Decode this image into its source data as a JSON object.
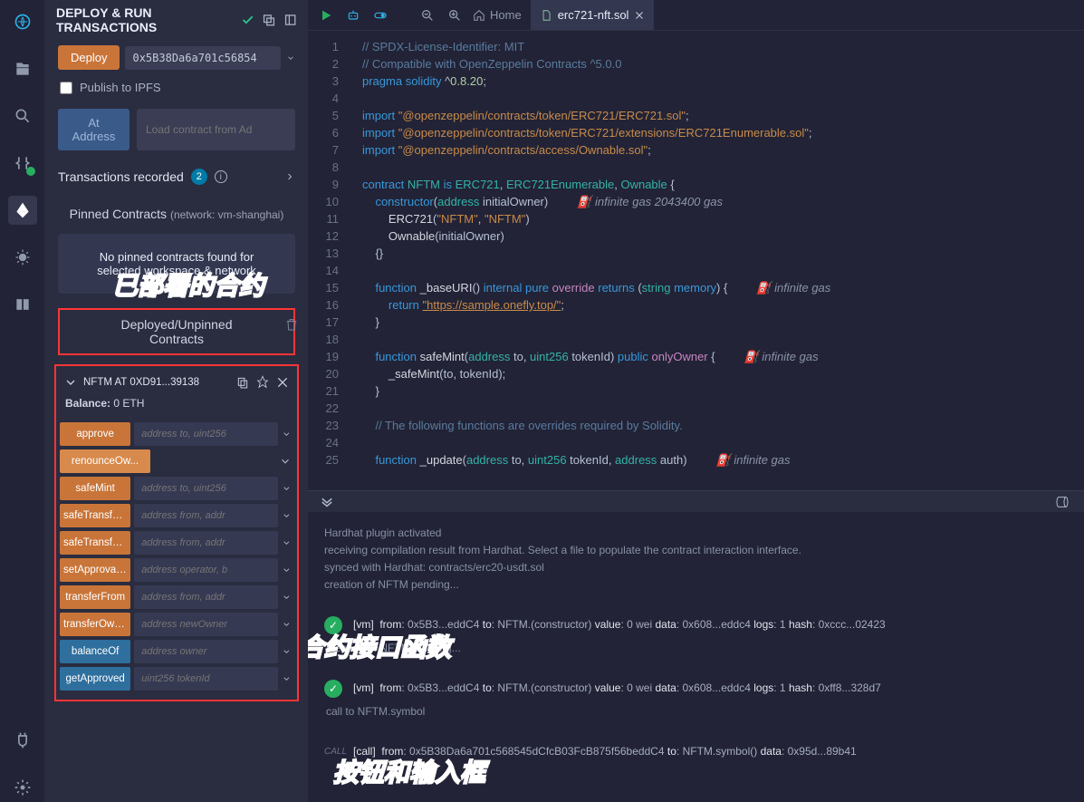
{
  "panel_title": "DEPLOY & RUN TRANSACTIONS",
  "deploy_btn": "Deploy",
  "deploy_addr": "0x5B38Da6a701c56854",
  "publish_ipfs": "Publish to IPFS",
  "at_address": "At Address",
  "load_from_addr": "Load contract from Ad",
  "tx_recorded": "Transactions recorded",
  "tx_count": "2",
  "pinned_title": "Pinned Contracts",
  "pinned_net": "(network: vm-shanghai)",
  "no_pinned_1": "No pinned contracts found for",
  "no_pinned_2": "selected workspace & network",
  "deployed_head_1": "Deployed/Unpinned",
  "deployed_head_2": "Contracts",
  "contract_name": "NFTM AT 0XD91...39138",
  "balance_lbl": "Balance:",
  "balance_val": "0 ETH",
  "fns": [
    {
      "name": "approve",
      "type": "write",
      "ph": "address to, uint256"
    },
    {
      "name": "renounceOw...",
      "type": "writew",
      "ph": ""
    },
    {
      "name": "safeMint",
      "type": "write",
      "ph": "address to, uint256"
    },
    {
      "name": "safeTransferFr...",
      "type": "write",
      "ph": "address from, addr"
    },
    {
      "name": "safeTransferFr...",
      "type": "write",
      "ph": "address from, addr"
    },
    {
      "name": "setApprovalF...",
      "type": "write",
      "ph": "address operator, b"
    },
    {
      "name": "transferFrom",
      "type": "write",
      "ph": "address from, addr"
    },
    {
      "name": "transferOwne...",
      "type": "write",
      "ph": "address newOwner"
    },
    {
      "name": "balanceOf",
      "type": "read",
      "ph": "address owner"
    },
    {
      "name": "getApproved",
      "type": "read",
      "ph": "uint256 tokenId"
    }
  ],
  "tabs": {
    "home": "Home",
    "file": "erc721-nft.sol"
  },
  "code_lines": [
    {
      "n": 1,
      "h": "<span class='c-comm'>// SPDX-License-Identifier: MIT</span>"
    },
    {
      "n": 2,
      "h": "<span class='c-comm'>// Compatible with OpenZeppelin Contracts ^5.0.0</span>"
    },
    {
      "n": 3,
      "h": "<span class='c-kw'>pragma</span> <span class='c-kw'>solidity</span> ^<span class='c-num'>0.8.20</span>;"
    },
    {
      "n": 4,
      "h": ""
    },
    {
      "n": 5,
      "h": "<span class='c-kw'>import</span> <span class='c-str'>\"@openzeppelin/contracts/token/ERC721/ERC721.sol\"</span>;"
    },
    {
      "n": 6,
      "h": "<span class='c-kw'>import</span> <span class='c-str'>\"@openzeppelin/contracts/token/ERC721/extensions/ERC721Enumerable.sol\"</span>;"
    },
    {
      "n": 7,
      "h": "<span class='c-kw'>import</span> <span class='c-str'>\"@openzeppelin/contracts/access/Ownable.sol\"</span>;"
    },
    {
      "n": 8,
      "h": ""
    },
    {
      "n": 9,
      "h": "<span class='c-kw'>contract</span> <span class='c-type'>NFTM</span> <span class='c-kw'>is</span> <span class='c-type'>ERC721</span>, <span class='c-type'>ERC721Enumerable</span>, <span class='c-type'>Ownable</span> {"
    },
    {
      "n": 10,
      "h": "    <span class='c-kw'>constructor</span>(<span class='c-type'>address</span> initialOwner)",
      "gas": "infinite gas 2043400 gas"
    },
    {
      "n": 11,
      "h": "        <span class='c-fn'>ERC721</span>(<span class='c-str'>\"NFTM\"</span>, <span class='c-str'>\"NFTM\"</span>)"
    },
    {
      "n": 12,
      "h": "        <span class='c-fn'>Ownable</span>(initialOwner)"
    },
    {
      "n": 13,
      "h": "    {}"
    },
    {
      "n": 14,
      "h": ""
    },
    {
      "n": 15,
      "h": "    <span class='c-kw'>function</span> <span class='c-fn'>_baseURI</span>() <span class='c-kw'>internal</span> <span class='c-kw'>pure</span> <span class='c-mod'>override</span> <span class='c-kw'>returns</span> (<span class='c-type'>string</span> <span class='c-kw'>memory</span>) {",
      "gas": "infinite gas"
    },
    {
      "n": 16,
      "h": "        <span class='c-kw'>return</span> <span class='c-link'>\"https://sample.onefly.top/\"</span>;"
    },
    {
      "n": 17,
      "h": "    }"
    },
    {
      "n": 18,
      "h": ""
    },
    {
      "n": 19,
      "h": "    <span class='c-kw'>function</span> <span class='c-fn'>safeMint</span>(<span class='c-type'>address</span> to, <span class='c-type'>uint256</span> tokenId) <span class='c-kw'>public</span> <span class='c-mod'>onlyOwner</span> {",
      "gas": "infinite gas"
    },
    {
      "n": 20,
      "h": "        <span class='c-fn'>_safeMint</span>(to, tokenId);"
    },
    {
      "n": 21,
      "h": "    }"
    },
    {
      "n": 22,
      "h": ""
    },
    {
      "n": 23,
      "h": "    <span class='c-comm'>// The following functions are overrides required by Solidity.</span>"
    },
    {
      "n": 24,
      "h": ""
    },
    {
      "n": 25,
      "h": "    <span class='c-kw'>function</span> <span class='c-fn'>_update</span>(<span class='c-type'>address</span> to, <span class='c-type'>uint256</span> tokenId, <span class='c-type'>address</span> auth)",
      "gas": "infinite gas"
    }
  ],
  "console_pre": [
    "Hardhat plugin activated",
    "receiving compilation result from Hardhat. Select a file to populate the contract interaction interface.",
    "synced with Hardhat: contracts/erc20-usdt.sol",
    "creation of NFTM pending..."
  ],
  "logs": [
    {
      "check": true,
      "tag": "[vm]",
      "body": "<span class='lg-b'>from</span>: 0x5B3...eddC4 <span class='lg-b'>to</span>: NFTM.(constructor) <span class='lg-b'>value</span>: 0 wei <span class='lg-b'>data</span>: 0x608...eddc4 <span class='lg-b'>logs</span>: 1 <span class='lg-b'>hash</span>: 0xccc...02423"
    },
    {
      "plain": "creation of NFTM pending..."
    },
    {
      "check": true,
      "tag": "[vm]",
      "body": "<span class='lg-b'>from</span>: 0x5B3...eddC4 <span class='lg-b'>to</span>: NFTM.(constructor) <span class='lg-b'>value</span>: 0 wei <span class='lg-b'>data</span>: 0x608...eddc4 <span class='lg-b'>logs</span>: 1 <span class='lg-b'>hash</span>: 0xff8...328d7"
    },
    {
      "plain": "call to NFTM.symbol"
    },
    {
      "call": true,
      "tag": "[call]",
      "body": "<span class='lg-b'>from</span>: 0x5B38Da6a701c568545dCfcB03FcB875f56beddC4 <span class='lg-b'>to</span>: NFTM.symbol() <span class='lg-b'>data</span>: 0x95d...89b41"
    }
  ],
  "annotations": {
    "a1": "已部署的合约",
    "a2": "合约接口函数",
    "a3": "按钮和输入框"
  }
}
